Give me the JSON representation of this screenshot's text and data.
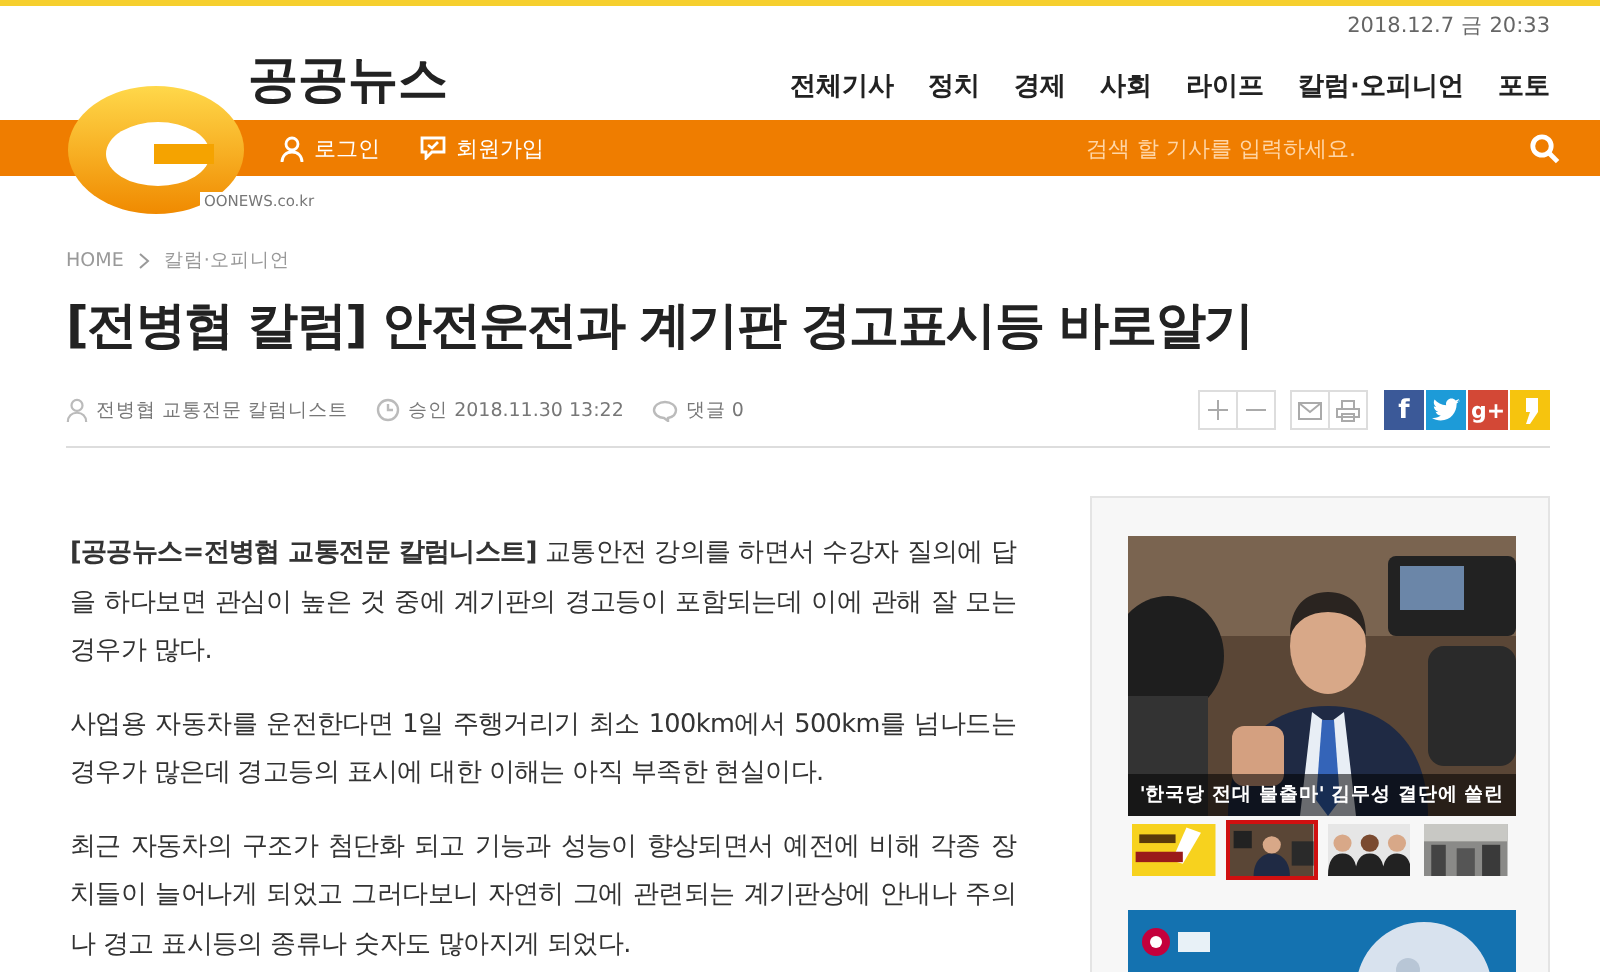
{
  "date": "2018.12.7 금 20:33",
  "logo": {
    "name": "공공뉴스",
    "domain": "OONEWS.co.kr"
  },
  "nav": [
    "전체기사",
    "정치",
    "경제",
    "사회",
    "라이프",
    "칼럼·오피니언",
    "포토"
  ],
  "user_links": [
    {
      "kind": "login",
      "label": "로그인"
    },
    {
      "kind": "join",
      "label": "회원가입"
    }
  ],
  "search": {
    "placeholder": "검색 할 기사를 입력하세요."
  },
  "breadcrumb": [
    "HOME",
    "칼럼·오피니언"
  ],
  "article": {
    "title": "[전병협 칼럼] 안전운전과 계기판 경고표시등 바로알기",
    "author": "전병협 교통전문 칼럼니스트",
    "approved": "승인 2018.11.30 13:22",
    "comments": "댓글 0",
    "paragraphs": [
      "**[공공뉴스=전병협 교통전문 칼럼니스트]** 교통안전 강의를 하면서 수강자 질의에 답을 하다보면 관심이 높은 것 중에 계기판의 경고등이 포함되는데 이에 관해 잘 모는 경우가 많다.",
      "사업용 자동차를 운전한다면 1일 주행거리기 최소 100km에서 500km를 넘나드는 경우가 많은데 경고등의 표시에 대한 이해는 아직 부족한 현실이다.",
      "최근 자동차의 구조가 첨단화 되고 기능과 성능이 향상되면서 예전에 비해 각종 장치들이 늘어나게 되었고 그러다보니 자연히 그에 관련되는 계기판상에 안내나 주의나 경고 표시등의 종류나 숫자도 많아지게 되었다."
    ]
  },
  "share": [
    {
      "kind": "facebook",
      "label": "f"
    },
    {
      "kind": "twitter"
    },
    {
      "kind": "google",
      "label": "g+"
    },
    {
      "kind": "kakao"
    }
  ],
  "sidebar": {
    "caption": "'한국당 전대 불출마' 김무성 결단에 쏠린",
    "thumbnails": [
      {
        "kind": "banner",
        "selected": false
      },
      {
        "kind": "press",
        "selected": true
      },
      {
        "kind": "people",
        "selected": false
      },
      {
        "kind": "crowd",
        "selected": false
      }
    ]
  }
}
